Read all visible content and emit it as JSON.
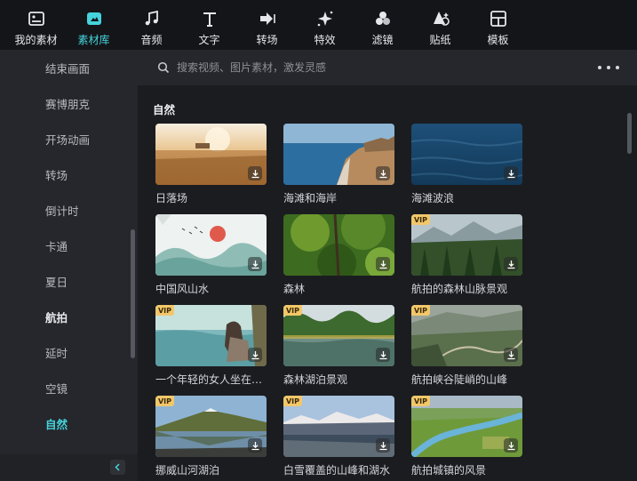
{
  "toolbar": {
    "items": [
      {
        "label": "我的素材",
        "icon": "my-media-icon"
      },
      {
        "label": "素材库",
        "icon": "stock-media-icon"
      },
      {
        "label": "音频",
        "icon": "music-note-icon"
      },
      {
        "label": "文字",
        "icon": "text-icon"
      },
      {
        "label": "转场",
        "icon": "transition-icon"
      },
      {
        "label": "特效",
        "icon": "sparkle-effects-icon"
      },
      {
        "label": "滤镜",
        "icon": "filter-circles-icon"
      },
      {
        "label": "贴纸",
        "icon": "sticker-icon"
      },
      {
        "label": "模板",
        "icon": "template-grid-icon"
      }
    ],
    "active_index": 1,
    "accent": "#45d3dc"
  },
  "sidebar": {
    "items": [
      {
        "label": "结束画面",
        "state": "normal"
      },
      {
        "label": "赛博朋克",
        "state": "normal"
      },
      {
        "label": "开场动画",
        "state": "normal"
      },
      {
        "label": "转场",
        "state": "normal"
      },
      {
        "label": "倒计时",
        "state": "normal"
      },
      {
        "label": "卡通",
        "state": "normal"
      },
      {
        "label": "夏日",
        "state": "normal"
      },
      {
        "label": "航拍",
        "state": "bold"
      },
      {
        "label": "延时",
        "state": "normal"
      },
      {
        "label": "空镜",
        "state": "normal"
      },
      {
        "label": "自然",
        "state": "active"
      }
    ]
  },
  "search": {
    "placeholder": "搜索视频、图片素材，激发灵感",
    "value": ""
  },
  "content": {
    "section_title": "自然",
    "vip_label": "VIP",
    "cards": [
      {
        "label": "日落场",
        "vip": false,
        "scene": "sunset-field"
      },
      {
        "label": "海滩和海岸",
        "vip": false,
        "scene": "beach-coast"
      },
      {
        "label": "海滩波浪",
        "vip": false,
        "scene": "ocean-waves"
      },
      {
        "label": "中国风山水",
        "vip": false,
        "scene": "chinese-landscape"
      },
      {
        "label": "森林",
        "vip": false,
        "scene": "forest"
      },
      {
        "label": "航拍的森林山脉景观",
        "vip": true,
        "scene": "aerial-forest-mountains"
      },
      {
        "label": "一个年轻的女人坐在…",
        "vip": true,
        "scene": "woman-sitting"
      },
      {
        "label": "森林湖泊景观",
        "vip": true,
        "scene": "forest-lake"
      },
      {
        "label": "航拍峡谷陡峭的山峰",
        "vip": true,
        "scene": "aerial-canyon"
      },
      {
        "label": "挪威山河湖泊",
        "vip": true,
        "scene": "norway-lake"
      },
      {
        "label": "白雪覆盖的山峰和湖水",
        "vip": true,
        "scene": "snowy-peaks-lake"
      },
      {
        "label": "航拍城镇的风景",
        "vip": true,
        "scene": "aerial-river-town"
      }
    ]
  }
}
